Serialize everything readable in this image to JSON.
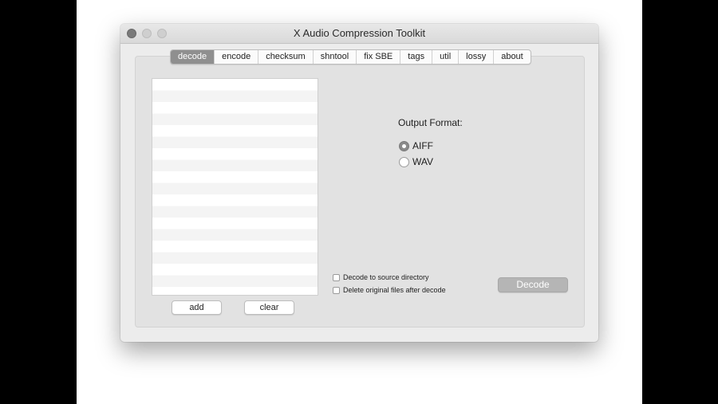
{
  "window": {
    "title": "X Audio Compression Toolkit"
  },
  "tabs": [
    {
      "label": "decode",
      "active": true
    },
    {
      "label": "encode",
      "active": false
    },
    {
      "label": "checksum",
      "active": false
    },
    {
      "label": "shntool",
      "active": false
    },
    {
      "label": "fix SBE",
      "active": false
    },
    {
      "label": "tags",
      "active": false
    },
    {
      "label": "util",
      "active": false
    },
    {
      "label": "lossy",
      "active": false
    },
    {
      "label": "about",
      "active": false
    }
  ],
  "file_list": {
    "buttons": {
      "add_label": "add",
      "clear_label": "clear"
    }
  },
  "output_format": {
    "label": "Output Format:",
    "options": [
      {
        "label": "AIFF",
        "selected": true
      },
      {
        "label": "WAV",
        "selected": false
      }
    ]
  },
  "options": {
    "decode_to_source": {
      "label": "Decode to source directory",
      "checked": false
    },
    "delete_originals": {
      "label": "Delete original files after decode",
      "checked": false
    }
  },
  "actions": {
    "decode_label": "Decode"
  },
  "colors": {
    "active_tab": "#8f8f8f",
    "window_bg": "#ececec",
    "decode_button": "#b5b5b5"
  }
}
